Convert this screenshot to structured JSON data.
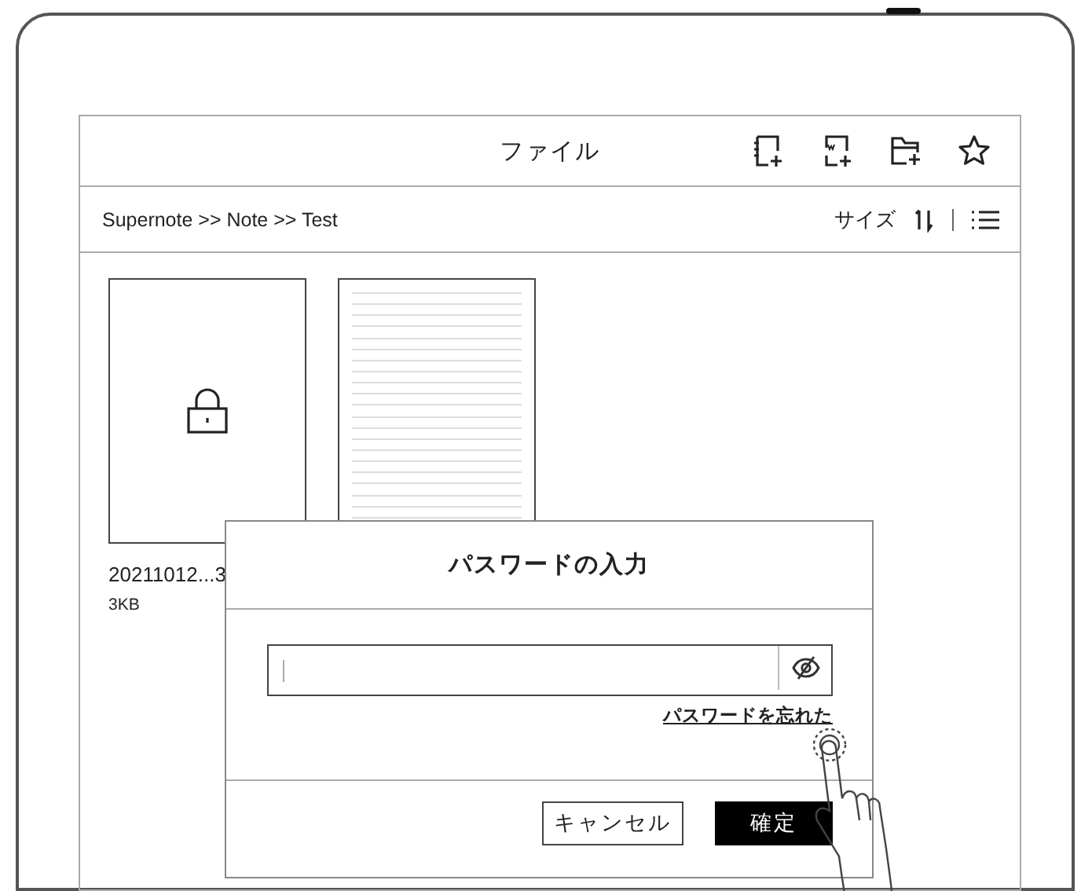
{
  "header": {
    "title": "ファイル"
  },
  "breadcrumb": {
    "path": "Supernote >> Note >> Test",
    "sort_label": "サイズ"
  },
  "files": [
    {
      "kind": "locked",
      "name": "20211012...3",
      "size": "3KB"
    },
    {
      "kind": "note"
    }
  ],
  "dialog": {
    "title": "パスワードの入力",
    "password_visible": false,
    "forgot_link": "パスワードを忘れた",
    "buttons": [
      {
        "label": "キャンセル",
        "kind": "secondary"
      },
      {
        "label": "確定",
        "kind": "primary"
      }
    ]
  }
}
